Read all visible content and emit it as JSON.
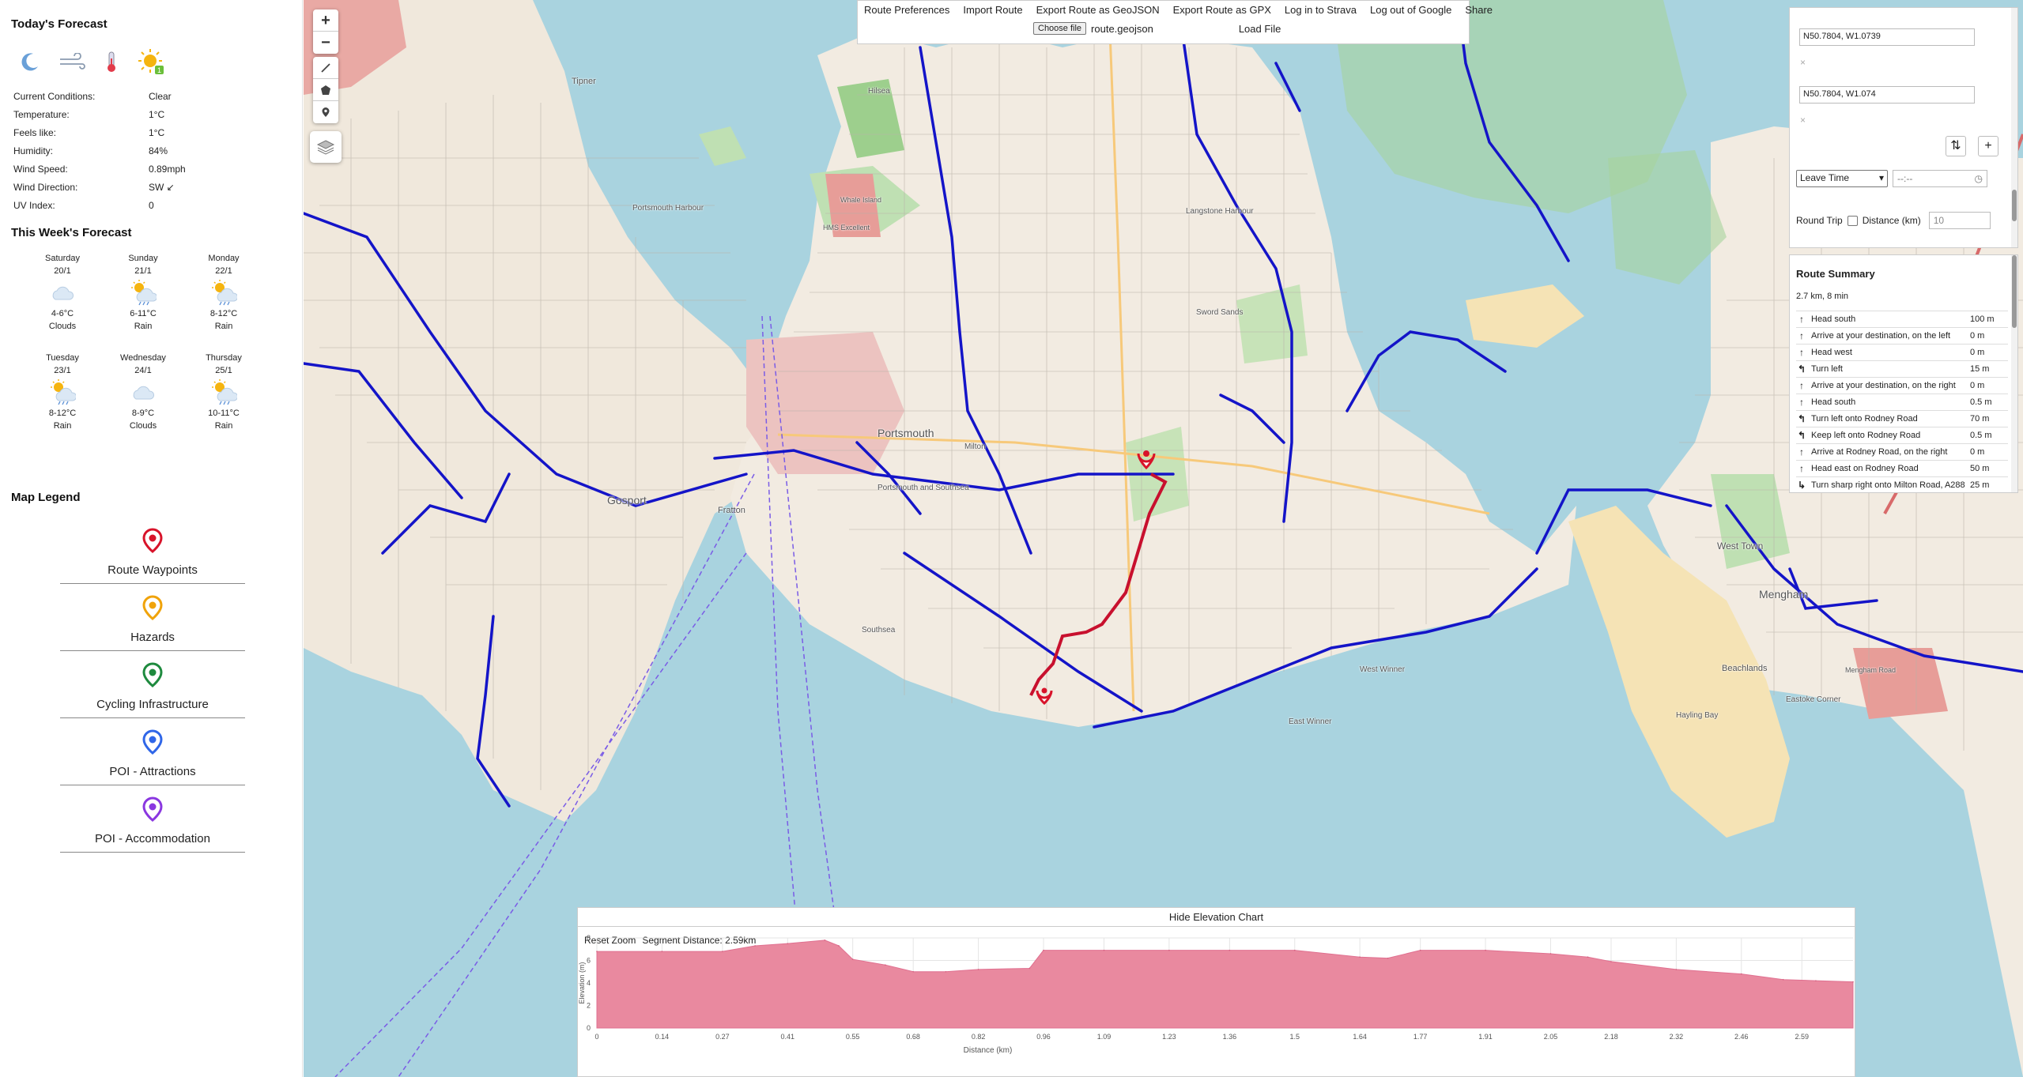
{
  "sidebar": {
    "today_title": "Today's Forecast",
    "conditions": [
      {
        "label": "Current Conditions:",
        "value": "Clear"
      },
      {
        "label": "Temperature:",
        "value": "1°C"
      },
      {
        "label": "Feels like:",
        "value": "1°C"
      },
      {
        "label": "Humidity:",
        "value": "84%"
      },
      {
        "label": "Wind Speed:",
        "value": "0.89mph"
      },
      {
        "label": "Wind Direction:",
        "value": "SW ↙"
      },
      {
        "label": "UV Index:",
        "value": "0"
      }
    ],
    "uv_badge": "1",
    "week_title": "This Week's Forecast",
    "week": [
      {
        "day": "Saturday",
        "date": "20/1",
        "temp": "4-6°C",
        "desc": "Clouds",
        "icon": "clouds-icon"
      },
      {
        "day": "Sunday",
        "date": "21/1",
        "temp": "6-11°C",
        "desc": "Rain",
        "icon": "sun-rain-icon"
      },
      {
        "day": "Monday",
        "date": "22/1",
        "temp": "8-12°C",
        "desc": "Rain",
        "icon": "sun-rain-icon"
      },
      {
        "day": "Tuesday",
        "date": "23/1",
        "temp": "8-12°C",
        "desc": "Rain",
        "icon": "sun-rain-icon"
      },
      {
        "day": "Wednesday",
        "date": "24/1",
        "temp": "8-9°C",
        "desc": "Clouds",
        "icon": "clouds-icon"
      },
      {
        "day": "Thursday",
        "date": "25/1",
        "temp": "10-11°C",
        "desc": "Rain",
        "icon": "sun-rain-icon"
      }
    ],
    "legend_title": "Map Legend",
    "legend": [
      {
        "label": "Route Waypoints",
        "color": "#d8132a"
      },
      {
        "label": "Hazards",
        "color": "#f0a30a"
      },
      {
        "label": "Cycling Infrastructure",
        "color": "#1e8a3e"
      },
      {
        "label": "POI - Attractions",
        "color": "#2f66e8"
      },
      {
        "label": "POI - Accommodation",
        "color": "#8a37e0"
      }
    ]
  },
  "toolbar": {
    "items": [
      "Route Preferences",
      "Import Route",
      "Export Route as GeoJSON",
      "Export Route as GPX",
      "Log in to Strava",
      "Log out of Google",
      "Share"
    ],
    "choose_file": "Choose file",
    "file_name": "route.geojson",
    "load_file": "Load File"
  },
  "route": {
    "start": "N50.7804, W1.0739",
    "end": "N50.7804, W1.074",
    "remove": "×",
    "swap": "⇅",
    "add": "+",
    "leave_option": "Leave Time",
    "time_placeholder": "--:--",
    "round_trip_label": "Round Trip",
    "distance_label": "Distance (km)",
    "distance_placeholder": "10"
  },
  "summary": {
    "title": "Route Summary",
    "total": "2.7 km, 8 min",
    "steps": [
      {
        "arrow": "↑",
        "text": "Head south",
        "dist": "100 m"
      },
      {
        "arrow": "↑",
        "text": "Arrive at your destination, on the left",
        "dist": "0 m"
      },
      {
        "arrow": "↑",
        "text": "Head west",
        "dist": "0 m"
      },
      {
        "arrow": "↰",
        "text": "Turn left",
        "dist": "15 m"
      },
      {
        "arrow": "↑",
        "text": "Arrive at your destination, on the right",
        "dist": "0 m"
      },
      {
        "arrow": "↑",
        "text": "Head south",
        "dist": "0.5 m"
      },
      {
        "arrow": "↰",
        "text": "Turn left onto Rodney Road",
        "dist": "70 m"
      },
      {
        "arrow": "↰",
        "text": "Keep left onto Rodney Road",
        "dist": "0.5 m"
      },
      {
        "arrow": "↑",
        "text": "Arrive at Rodney Road, on the right",
        "dist": "0 m"
      },
      {
        "arrow": "↑",
        "text": "Head east on Rodney Road",
        "dist": "50 m"
      },
      {
        "arrow": "↳",
        "text": "Turn sharp right onto Milton Road, A288",
        "dist": "25 m"
      }
    ]
  },
  "map": {
    "labels": [
      "Portsmouth",
      "Gosport",
      "Fratton",
      "Portsmouth Harbour",
      "Langstone Harbour",
      "Hilsea",
      "Tipner",
      "Milton",
      "Southsea",
      "West Town",
      "Mengham",
      "Beachlands",
      "Eastoke Corner",
      "Hayling Bay",
      "West Winner",
      "East Winner",
      "Sword Sands",
      "Whale Island",
      "HMS Excellent",
      "Mengham Road",
      "Portsmouth and Southsea"
    ],
    "route_color": "#c8102e",
    "cycle_color": "#1414c8"
  },
  "elevation": {
    "header": "Hide Elevation Chart",
    "reset": "Reset Zoom",
    "segment": "Segment Distance: 2.59km"
  },
  "chart_data": {
    "type": "area",
    "xlabel": "Distance (km)",
    "ylabel": "Elevation (m)",
    "xticks": [
      "0",
      "0.14",
      "0.27",
      "0.41",
      "0.55",
      "0.68",
      "0.82",
      "0.96",
      "1.09",
      "1.23",
      "1.36",
      "1.5",
      "1.64",
      "1.77",
      "1.91",
      "2.05",
      "2.18",
      "2.32",
      "2.46",
      "2.59"
    ],
    "yticks": [
      "0",
      "2",
      "4",
      "6",
      "8"
    ],
    "xlim": [
      0,
      2.7
    ],
    "ylim": [
      0,
      8
    ],
    "x": [
      0,
      0.14,
      0.27,
      0.34,
      0.41,
      0.49,
      0.52,
      0.55,
      0.62,
      0.68,
      0.75,
      0.82,
      0.93,
      0.96,
      1.09,
      1.23,
      1.36,
      1.5,
      1.64,
      1.7,
      1.77,
      1.91,
      2.05,
      2.13,
      2.18,
      2.32,
      2.46,
      2.55,
      2.62,
      2.7
    ],
    "y": [
      6.8,
      6.8,
      6.8,
      7.3,
      7.5,
      7.8,
      7.3,
      6.1,
      5.6,
      5.0,
      5.0,
      5.2,
      5.3,
      6.9,
      6.9,
      6.9,
      6.9,
      6.9,
      6.3,
      6.2,
      6.9,
      6.9,
      6.6,
      6.3,
      5.9,
      5.2,
      4.8,
      4.3,
      4.2,
      4.1
    ],
    "color": "#e9899f"
  }
}
